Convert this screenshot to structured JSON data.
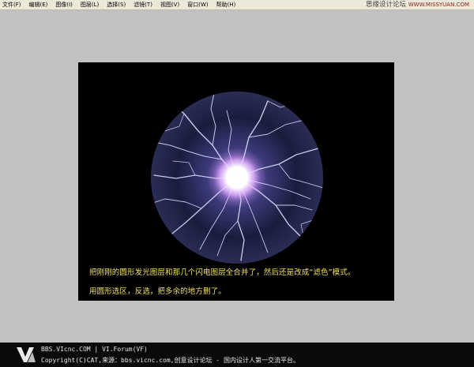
{
  "menubar": {
    "items": [
      {
        "label": "文件(F)"
      },
      {
        "label": "编辑(E)"
      },
      {
        "label": "图像(I)"
      },
      {
        "label": "图层(L)"
      },
      {
        "label": "选择(S)"
      },
      {
        "label": "滤镜(T)"
      },
      {
        "label": "视图(V)"
      },
      {
        "label": "窗口(W)"
      },
      {
        "label": "帮助(H)"
      }
    ]
  },
  "watermark": {
    "name": "思缘设计论坛",
    "site": "WWW.MISSYUAN.COM"
  },
  "canvas": {
    "image_icon": "plasma-ball-lightning-image",
    "captions": [
      "把刚刚的圆形发光图层和那几个闪电图层全合并了，然后还是改成“滤色”模式。",
      "用圆形选区，反选，把多余的地方删了。"
    ]
  },
  "footer": {
    "logo_icon": "vi-logo-icon",
    "line1": "BBS.VIcnc.COM | VI.Forum(VF)",
    "line2": "Copyright(C)CAT,来源：bbs.vicnc.com,创意设计论坛 - 国内设计人第一交流平台。"
  },
  "colors": {
    "background": "#c2c2c2",
    "menubar": "#ece9d8",
    "canvas": "#000000",
    "caption": "#f2e35a",
    "footer": "#0a0a0a"
  }
}
